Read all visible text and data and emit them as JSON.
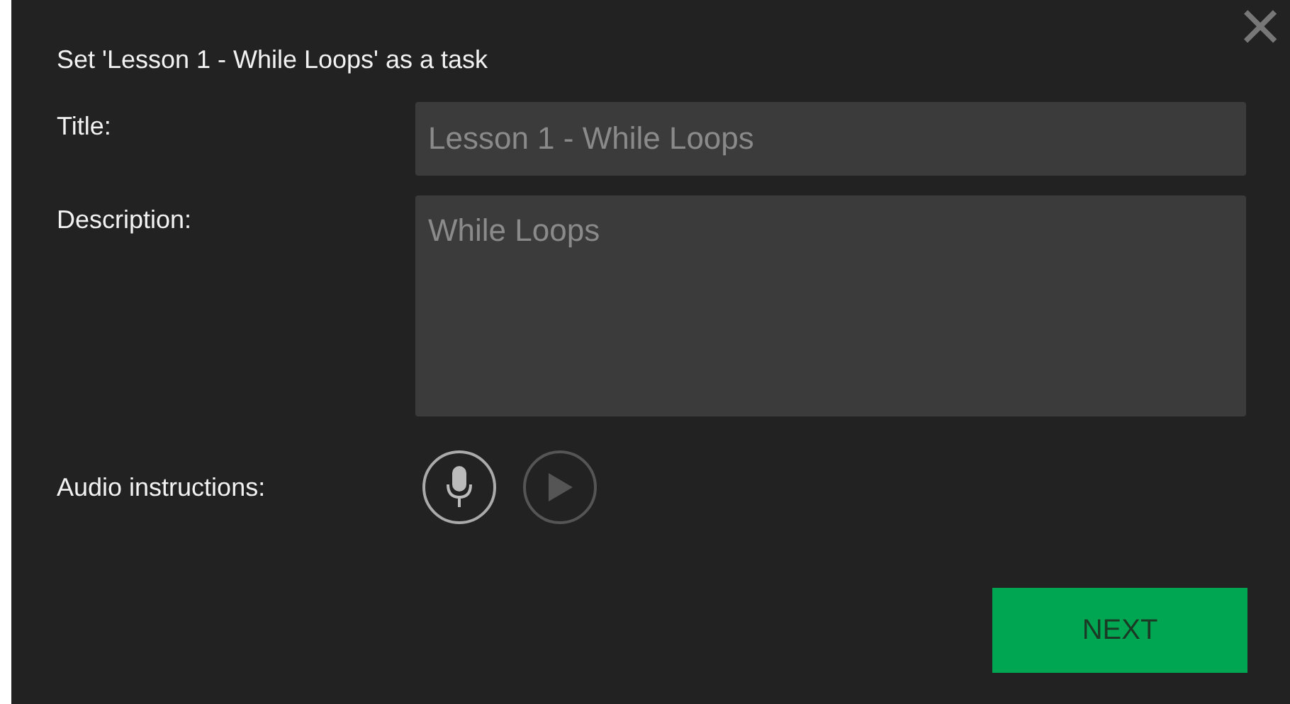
{
  "dialog": {
    "title": "Set 'Lesson 1 - While Loops' as a task",
    "close": "×"
  },
  "fields": [
    {
      "label": "Title:",
      "kind": "line",
      "value": "Lesson 1 - While Loops"
    },
    {
      "label": "Description:",
      "kind": "area",
      "value": "While Loops"
    }
  ],
  "audio": {
    "label": "Audio instructions:",
    "controls": [
      {
        "kind": "record",
        "disabled": false
      },
      {
        "kind": "play",
        "disabled": true
      }
    ]
  },
  "next_button": "NEXT"
}
